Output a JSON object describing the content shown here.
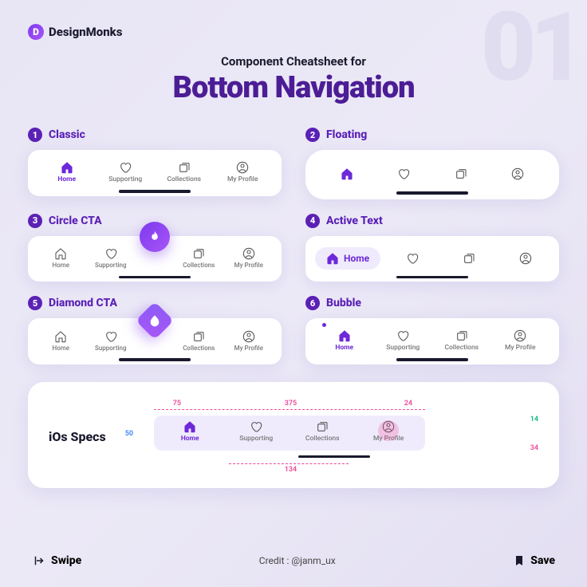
{
  "bg_number": "01",
  "brand": {
    "icon_letter": "D",
    "name": "DesignMonks"
  },
  "subtitle": "Component Cheatsheet for",
  "title": "Bottom Navigation",
  "sections": {
    "classic": {
      "num": "1",
      "title": "Classic",
      "items": [
        "Home",
        "Supporting",
        "Collections",
        "My Profile"
      ]
    },
    "floating": {
      "num": "2",
      "title": "Floating"
    },
    "circle_cta": {
      "num": "3",
      "title": "Circle CTA",
      "items": [
        "Home",
        "Supporting",
        "Collections",
        "My Profile"
      ]
    },
    "active_text": {
      "num": "4",
      "title": "Active Text",
      "pill_label": "Home"
    },
    "diamond_cta": {
      "num": "5",
      "title": "Diamond CTA",
      "items": [
        "Home",
        "Supporting",
        "Collections",
        "My Profile"
      ]
    },
    "bubble": {
      "num": "6",
      "title": "Bubble",
      "items": [
        "Home",
        "Supporting",
        "Collections",
        "My Profile"
      ]
    }
  },
  "specs": {
    "title": "iOs Specs",
    "items": [
      "Home",
      "Supporting",
      "Collections",
      "My Profile"
    ],
    "dims": {
      "w1": "75",
      "w2": "375",
      "w3": "24",
      "h1": "50",
      "h2": "14",
      "h3": "34",
      "w4": "134"
    }
  },
  "footer": {
    "swipe": "Swipe",
    "save": "Save",
    "credit": "Credit : @janm_ux"
  }
}
